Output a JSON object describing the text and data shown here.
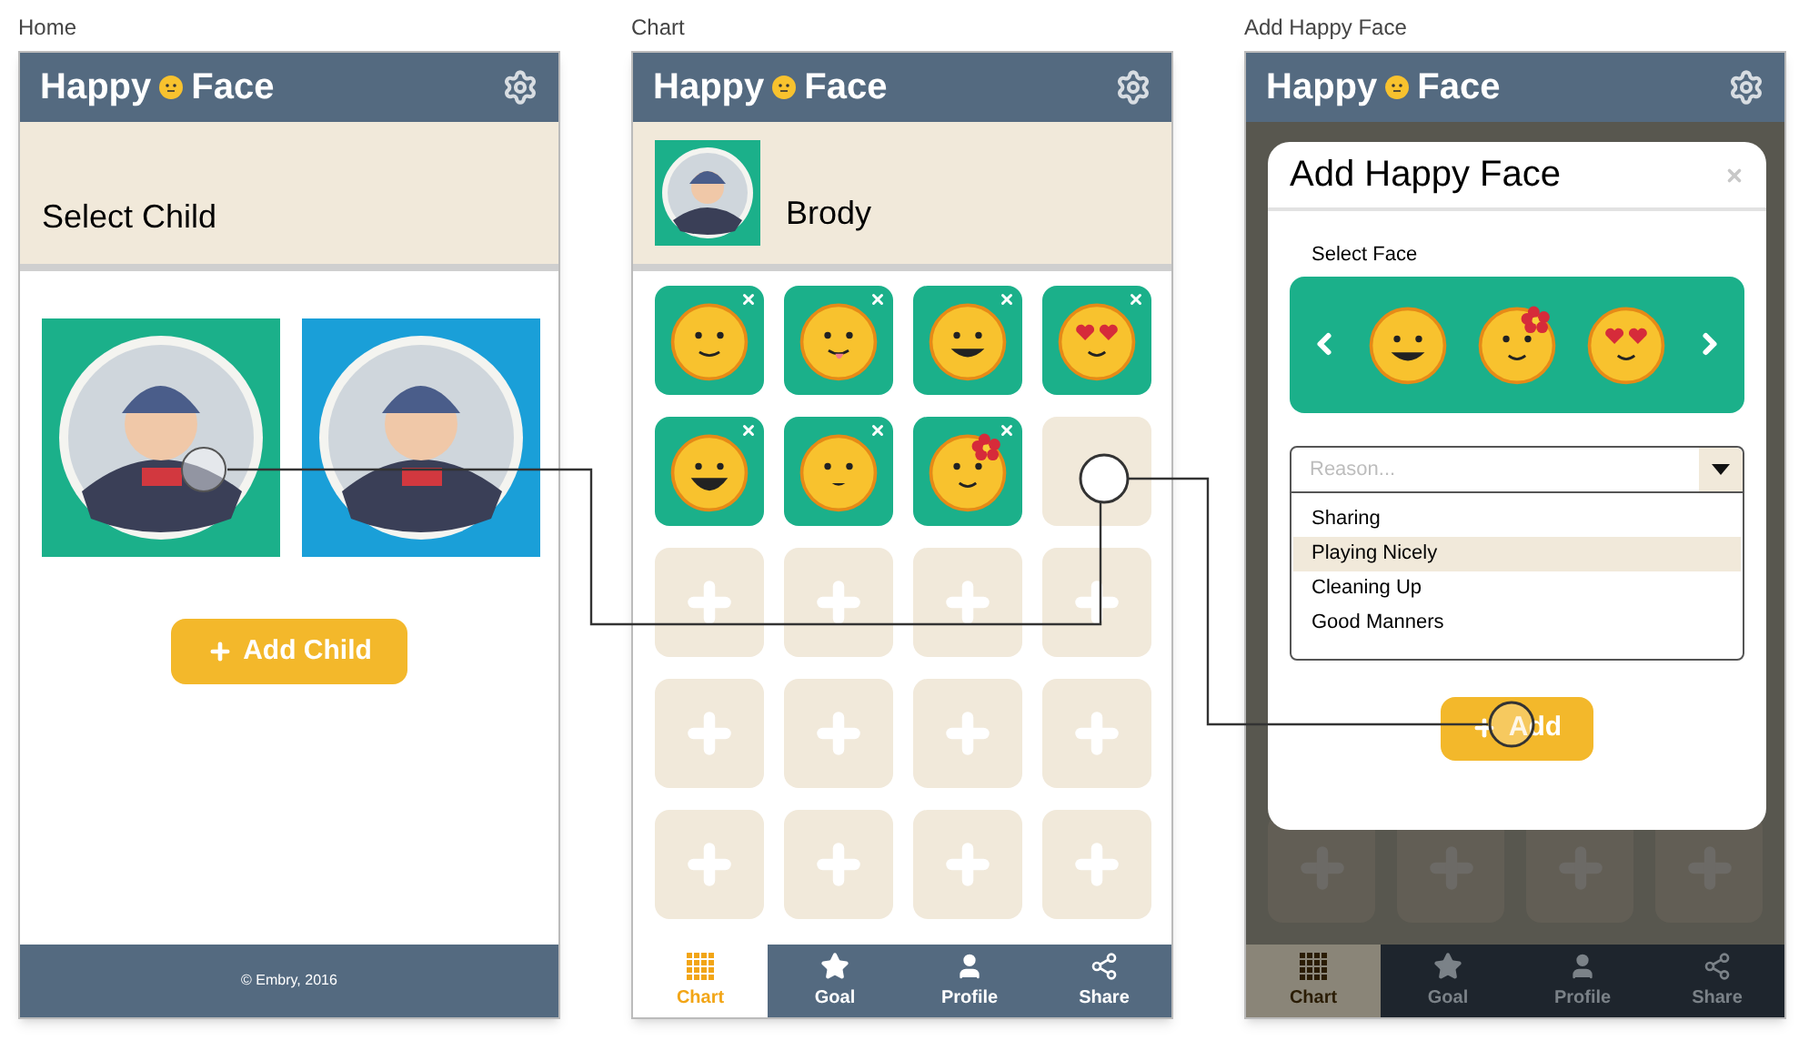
{
  "screens": [
    {
      "kind": "home",
      "caption": "Home",
      "app_title": [
        "Happy",
        "Face"
      ],
      "section_title": "Select Child",
      "child_cards": [
        {
          "kind": "picture",
          "color": "#1bb08a"
        },
        {
          "kind": "picture",
          "color": "#1a9fd8"
        }
      ],
      "add_button": "Add Child",
      "footer": "© Embry, 2016"
    },
    {
      "kind": "chart",
      "caption": "Chart",
      "app_title": [
        "Happy",
        "Face"
      ],
      "child_name": "Brody",
      "cells": [
        {
          "kind": "smile"
        },
        {
          "kind": "tongue"
        },
        {
          "kind": "grin"
        },
        {
          "kind": "hearts"
        },
        {
          "kind": "laugh"
        },
        {
          "kind": "small"
        },
        {
          "kind": "flower"
        },
        {
          "kind": "blank"
        },
        {
          "kind": "add"
        },
        {
          "kind": "add"
        },
        {
          "kind": "add"
        },
        {
          "kind": "add"
        },
        {
          "kind": "add"
        },
        {
          "kind": "add"
        },
        {
          "kind": "add"
        },
        {
          "kind": "add"
        },
        {
          "kind": "add"
        },
        {
          "kind": "add"
        },
        {
          "kind": "add"
        },
        {
          "kind": "add"
        }
      ],
      "tabs": [
        {
          "label": "Chart",
          "selected": true
        },
        {
          "label": "Goal",
          "selected": false
        },
        {
          "label": "Profile",
          "selected": false
        },
        {
          "label": "Share",
          "selected": false
        }
      ]
    },
    {
      "kind": "modal",
      "caption": "Add Happy Face",
      "app_title": [
        "Happy",
        "Face"
      ],
      "modal": {
        "title": "Add Happy Face",
        "face_label": "Select Face",
        "faces": [
          {
            "kind": "grin"
          },
          {
            "kind": "flower"
          },
          {
            "kind": "hearts"
          }
        ],
        "reason_placeholder": "Reason...",
        "options": [
          {
            "label": "Sharing",
            "selected": false
          },
          {
            "label": "Playing Nicely",
            "selected": true
          },
          {
            "label": "Cleaning Up",
            "selected": false
          },
          {
            "label": "Good Manners",
            "selected": false
          }
        ],
        "add_button": "Add"
      },
      "tabs": [
        {
          "label": "Chart",
          "selected": true
        },
        {
          "label": "Goal",
          "selected": false
        },
        {
          "label": "Profile",
          "selected": false
        },
        {
          "label": "Share",
          "selected": false
        }
      ]
    }
  ]
}
